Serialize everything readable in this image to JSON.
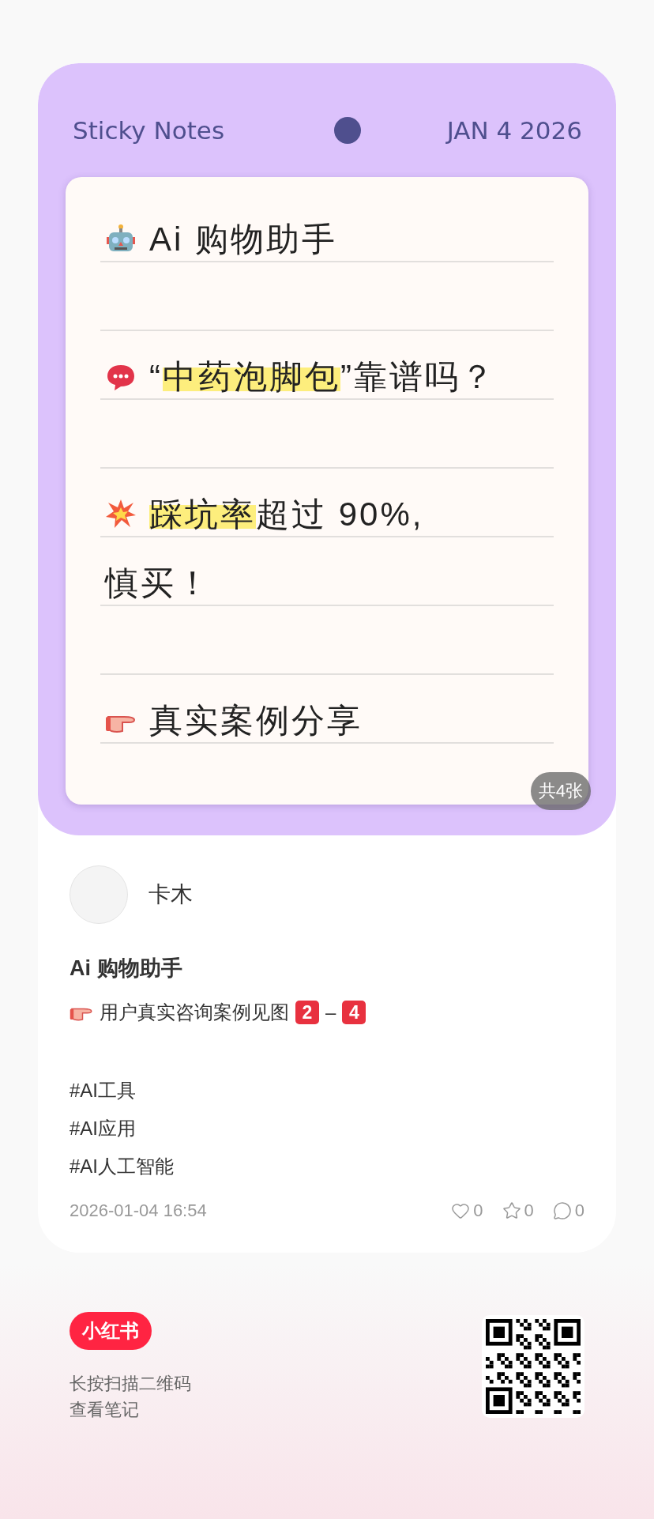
{
  "note_image": {
    "header": {
      "title": "Sticky Notes",
      "date": "JAN 4 2026"
    },
    "lines": [
      {
        "kind": "robot",
        "segments": [
          {
            "text": "Ai 购物助手",
            "highlight": false
          }
        ]
      },
      {
        "kind": "blank"
      },
      {
        "kind": "bubble",
        "segments": [
          {
            "text": "“",
            "highlight": false
          },
          {
            "text": "中药泡脚包",
            "highlight": true
          },
          {
            "text": "”靠谱吗？",
            "highlight": false
          }
        ]
      },
      {
        "kind": "blank"
      },
      {
        "kind": "burst",
        "segments": [
          {
            "text": "踩坑率",
            "highlight": true
          },
          {
            "text": "超过 90%,",
            "highlight": false
          }
        ]
      },
      {
        "kind": "plain",
        "segments": [
          {
            "text": "慎买！",
            "highlight": false
          }
        ]
      },
      {
        "kind": "blank"
      },
      {
        "kind": "hand",
        "segments": [
          {
            "text": "真实案例分享",
            "highlight": false
          }
        ]
      }
    ],
    "count_badge": "共4张"
  },
  "author": {
    "name": "卡木"
  },
  "post": {
    "title": "Ai 购物助手",
    "description": [
      {
        "kind": "hand"
      },
      {
        "kind": "text",
        "text": "用户真实咨询案例见图"
      },
      {
        "kind": "keycap",
        "text": "2"
      },
      {
        "kind": "text",
        "text": "–"
      },
      {
        "kind": "keycap",
        "text": "4"
      }
    ],
    "tags": [
      "#AI工具",
      "#AI应用",
      "#AI人工智能"
    ],
    "date": "2026-01-04 16:54",
    "stats": [
      {
        "kind": "like",
        "count": "0"
      },
      {
        "kind": "star",
        "count": "0"
      },
      {
        "kind": "comment",
        "count": "0"
      }
    ]
  },
  "footer": {
    "logo": "小红书",
    "hint_lines": [
      "长按扫描二维码",
      "查看笔记"
    ]
  }
}
